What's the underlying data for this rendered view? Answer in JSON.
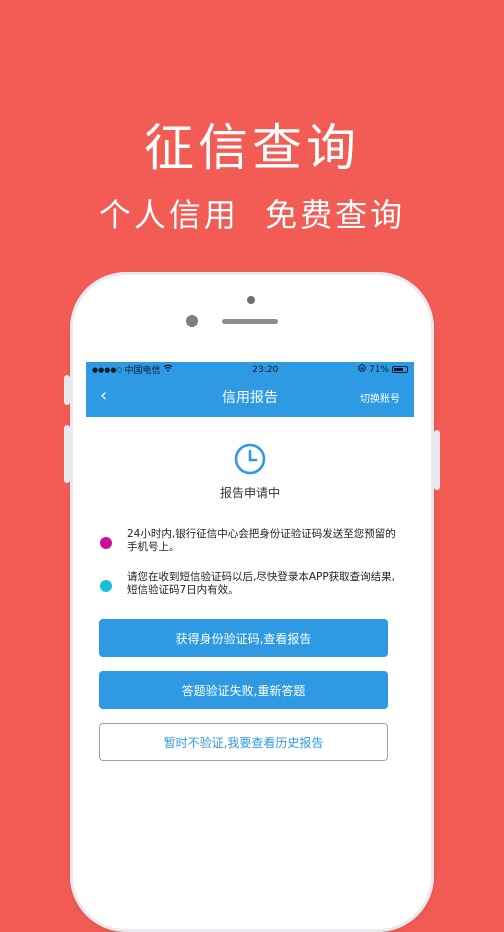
{
  "promo": {
    "title": "征信查询",
    "subtitle": "个人信用  免费查询"
  },
  "statusbar": {
    "signal": "●●●●○",
    "carrier": "中国电信",
    "wifi_icon": "wifi-icon",
    "time": "23:20",
    "battery_percent": "71%"
  },
  "navbar": {
    "back": "‹",
    "title": "信用报告",
    "switch_account": "切换账号"
  },
  "report": {
    "status_icon": "clock-icon",
    "status_text": "报告申请中"
  },
  "notes": [
    {
      "text": "24小时内,银行征信中心会把身份证验证码发送至您预留的手机号上。",
      "dot_color": "#cc0f9a"
    },
    {
      "text": "请您在收到短信验证码以后,尽快登录本APP获取查询结果,短信验证码7日内有效。",
      "dot_color": "#19c1d8"
    }
  ],
  "buttons": {
    "get_code": "获得身份验证码,查看报告",
    "retry_answer": "答题验证失败,重新答题",
    "view_history": "暂时不验证,我要查看历史报告"
  },
  "colors": {
    "background": "#f25c55",
    "brand_blue": "#2e9ae4"
  }
}
